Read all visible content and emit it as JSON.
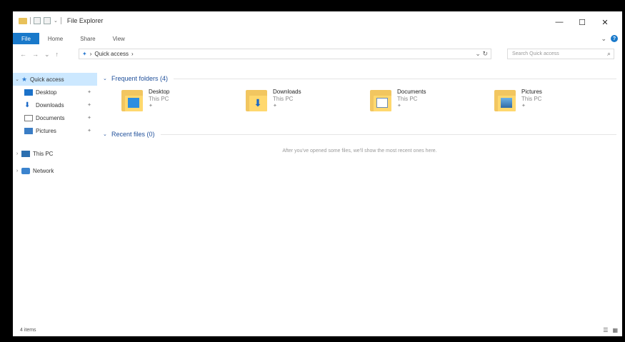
{
  "window": {
    "title": "File Explorer",
    "controls": {
      "minimize": "—",
      "maximize": "☐",
      "close": "✕"
    }
  },
  "ribbon": {
    "tabs": [
      "File",
      "Home",
      "Share",
      "View"
    ],
    "expand": "⌄",
    "help": "?"
  },
  "nav": {
    "back": "←",
    "forward": "→",
    "up_list": "⌄",
    "up": "↑"
  },
  "address": {
    "pin": "✦",
    "path": "Quick access",
    "sep": "›",
    "dropdown": "⌄",
    "refresh": "↻"
  },
  "search": {
    "placeholder": "Search Quick access",
    "icon": "⌕"
  },
  "sidebar": {
    "items": [
      {
        "label": "Quick access",
        "chev": "⌄",
        "pin": ""
      },
      {
        "label": "Desktop",
        "pin": "✦"
      },
      {
        "label": "Downloads",
        "pin": "✦"
      },
      {
        "label": "Documents",
        "pin": "✦"
      },
      {
        "label": "Pictures",
        "pin": "✦"
      },
      {
        "label": "This PC",
        "chev": "›"
      },
      {
        "label": "Network",
        "chev": "›"
      }
    ]
  },
  "main": {
    "frequent_header": "Frequent folders (4)",
    "recent_header": "Recent files (0)",
    "folders": [
      {
        "name": "Desktop",
        "location": "This PC",
        "pin": "✦"
      },
      {
        "name": "Downloads",
        "location": "This PC",
        "pin": "✦"
      },
      {
        "name": "Documents",
        "location": "This PC",
        "pin": "✦"
      },
      {
        "name": "Pictures",
        "location": "This PC",
        "pin": "✦"
      }
    ],
    "empty_message": "After you've opened some files, we'll show the most recent ones here."
  },
  "status": {
    "count": "4 items",
    "view_details": "☰",
    "view_tiles": "▦"
  }
}
